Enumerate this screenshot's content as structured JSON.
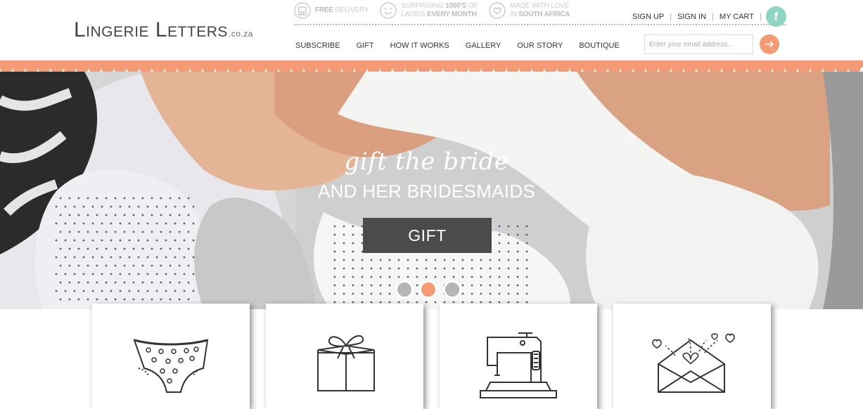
{
  "logo": {
    "name": "Lingerie Letters",
    "tld": ".co.za"
  },
  "features": [
    {
      "icon": "delivery-box-icon",
      "html_bold": "FREE",
      "text": " DELIVERY"
    },
    {
      "icon": "smiley-icon",
      "line1": "SURPRISING ",
      "bold1": "1000'S",
      "line1b": " OF",
      "line2": "LADIES ",
      "bold2": "EVERY MONTH"
    },
    {
      "icon": "heart-icon",
      "line1": "MADE WITH LOVE",
      "line2": "IN ",
      "bold2": "SOUTH AFRICA"
    }
  ],
  "account": {
    "sign_up": "SIGN UP",
    "sign_in": "SIGN IN",
    "cart": "MY CART",
    "facebook": "f"
  },
  "nav": [
    "SUBSCRIBE",
    "GIFT",
    "HOW IT WORKS",
    "GALLERY",
    "OUR STORY",
    "BOUTIQUE"
  ],
  "newsletter": {
    "placeholder": "Enter your email address..."
  },
  "hero": {
    "script": "gift the bride",
    "subtitle": "AND HER BRIDESMAIDS",
    "cta": "GIFT",
    "slides": 3,
    "active_slide": 2
  },
  "cards": [
    {
      "icon": "panties-icon"
    },
    {
      "icon": "gift-box-icon"
    },
    {
      "icon": "sewing-machine-icon"
    },
    {
      "icon": "love-letter-icon"
    }
  ],
  "colors": {
    "accent": "#f49a75",
    "facebook": "#8fd6c2",
    "cta_bg": "#4b4b4b"
  }
}
